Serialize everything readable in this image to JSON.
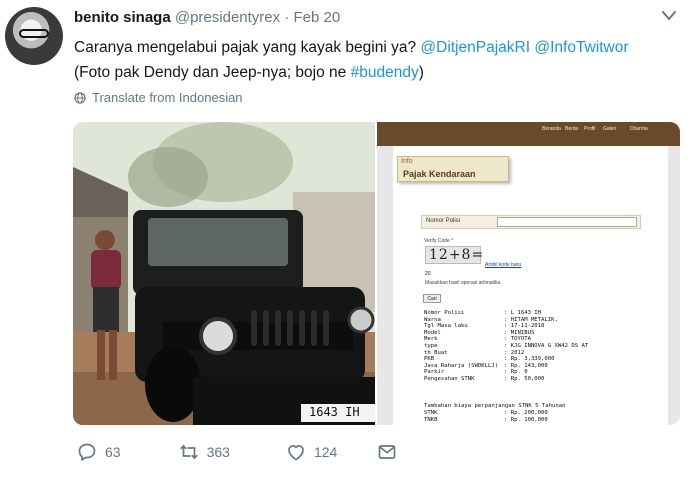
{
  "author": {
    "name": "benito sinaga",
    "handle": "@presidentyrex",
    "date": "Feb 20"
  },
  "tweet": {
    "line1_text": "Caranya mengelabui pajak yang kayak begini ya?",
    "mention1": "@DitjenPajakRI",
    "mention2": "@InfoTwitwor",
    "line2_text": "(Foto pak Dendy dan Jeep-nya; bojo ne",
    "hashtag": "#budendy",
    "line2_end": ")"
  },
  "translate_label": "Translate from Indonesian",
  "jeep_plate": "1643 IH",
  "screenshot": {
    "nav": [
      "Beranda",
      "Berita",
      "Profil",
      "Galeri",
      "Dharma"
    ],
    "info_label": "Info",
    "section_title": "Pajak Kendaraan",
    "nomor_polisi_label": "Nomor Polisi",
    "verify_label": "Verify Code *",
    "captcha_text": "12+8=",
    "captcha_refresh": "Ambil kode baru",
    "captcha_answer": "20",
    "captcha_hint": "Masukkan hasil operasi aritmatika",
    "submit_label": "Cari",
    "rows": [
      {
        "label": "Nomor Polisi",
        "value": ": L 1643 IH"
      },
      {
        "label": "Warna",
        "value": ": HITAM METALIK,"
      },
      {
        "label": "Tgl Masa laku",
        "value": ": 17-11-2018"
      },
      {
        "label": "Model",
        "value": ": MINIBUS"
      },
      {
        "label": "Merk",
        "value": ": TOYOTA"
      },
      {
        "label": "type",
        "value": ": KJG INNOVA G XW42 DS AT"
      },
      {
        "label": "th Buat",
        "value": ": 2012"
      },
      {
        "label": "PKB",
        "value": ": Rp. 3,339,000"
      },
      {
        "label": "Jasa Raharja (SWDKLLJ)",
        "value": ": Rp. 143,000"
      },
      {
        "label": "Parkir",
        "value": ": Rp. 0"
      },
      {
        "label": "Pengesahan STNK",
        "value": ": Rp. 50,000"
      }
    ],
    "extra_title": "Tambahan biaya perpanjangan STNK 5 Tahunan",
    "extra_rows": [
      {
        "label": "STNK",
        "value": ": Rp. 200,000"
      },
      {
        "label": "TNKB",
        "value": ": Rp. 100,000"
      }
    ]
  },
  "actions": {
    "replies": "63",
    "retweets": "363",
    "likes": "124"
  },
  "colors": {
    "link": "#1b95e0",
    "muted": "#657786",
    "header_brown": "#5b3a1f"
  }
}
